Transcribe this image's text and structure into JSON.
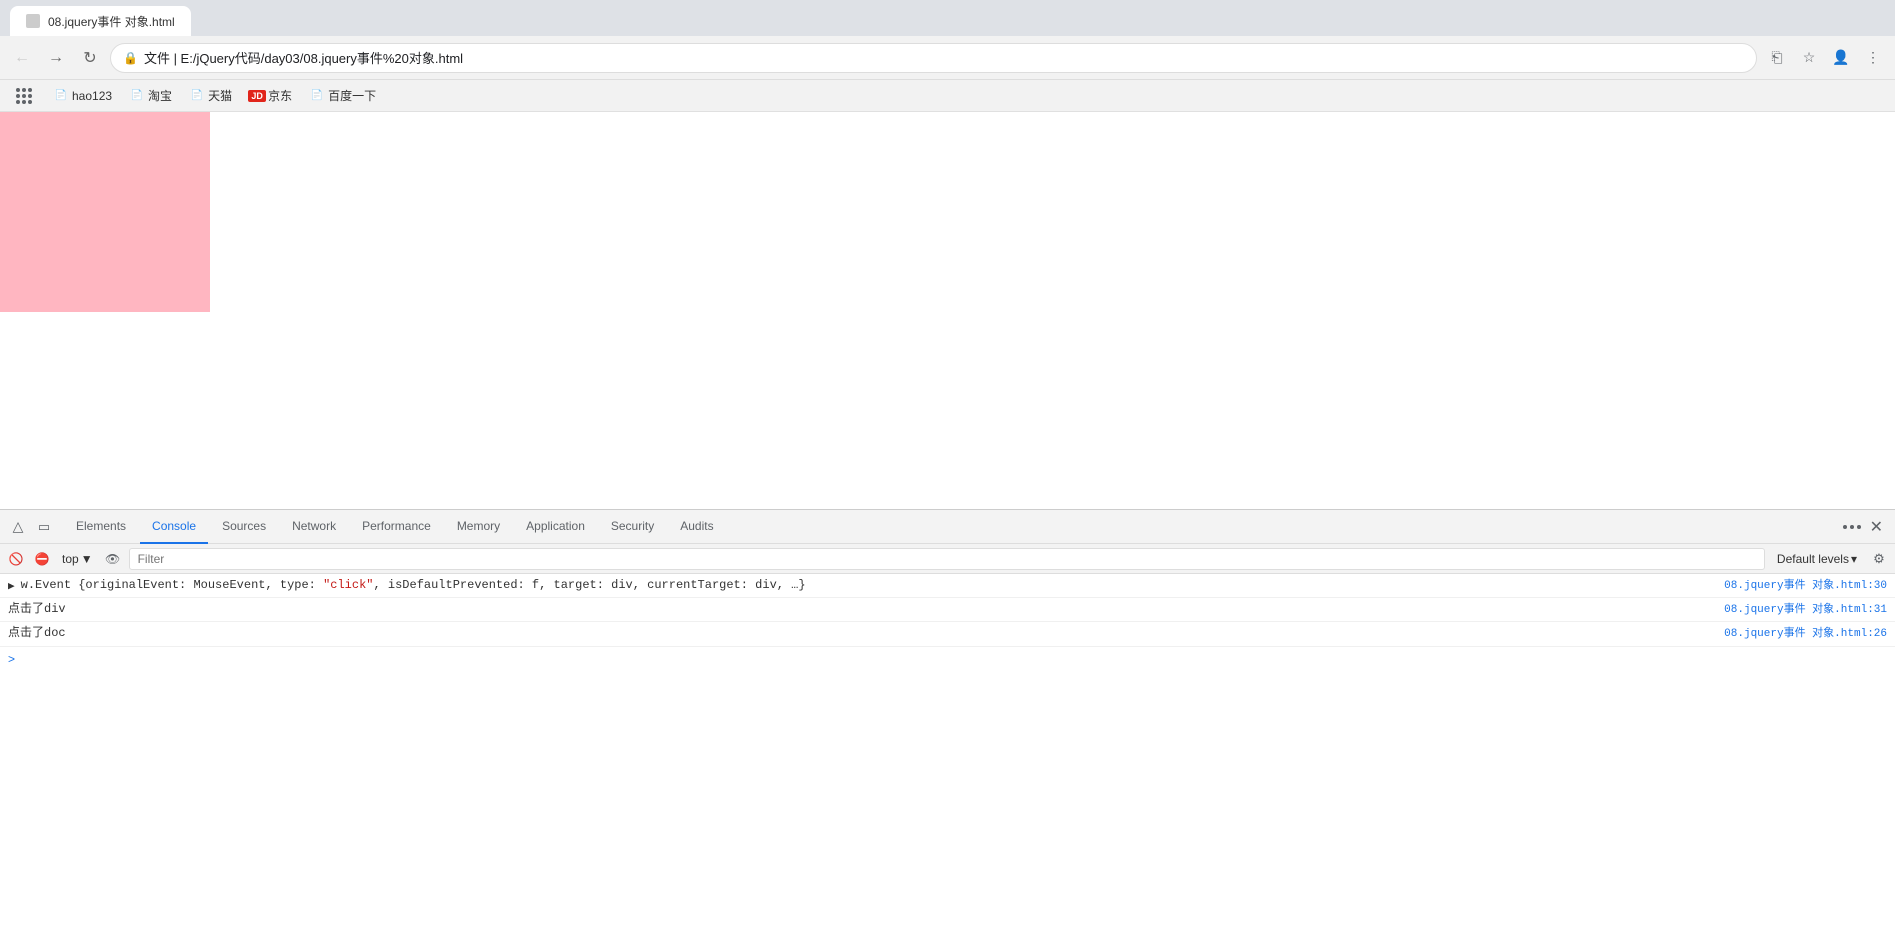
{
  "browser": {
    "tab": {
      "title": "08.jquery事件 对象.html"
    },
    "address": {
      "lock_icon": "🔒",
      "url": "文件 | E:/jQuery代码/day03/08.jquery事件%20对象.html"
    },
    "nav": {
      "back_label": "←",
      "forward_label": "→",
      "reload_label": "↻"
    },
    "browser_actions": {
      "translate_icon": "⊕",
      "bookmark_icon": "☆",
      "profile_icon": "👤",
      "menu_icon": "⋮"
    }
  },
  "bookmarks": [
    {
      "id": "apps",
      "label": "",
      "type": "apps"
    },
    {
      "id": "hao123",
      "label": "hao123",
      "icon": "📄"
    },
    {
      "id": "taobao",
      "label": "淘宝",
      "icon": "📄"
    },
    {
      "id": "tianmao",
      "label": "天猫",
      "icon": "📄"
    },
    {
      "id": "jd",
      "label": "京东",
      "icon": "jd"
    },
    {
      "id": "baidu",
      "label": "百度一下",
      "icon": "📄"
    }
  ],
  "devtools": {
    "tabs": [
      {
        "id": "elements",
        "label": "Elements"
      },
      {
        "id": "console",
        "label": "Console"
      },
      {
        "id": "sources",
        "label": "Sources"
      },
      {
        "id": "network",
        "label": "Network"
      },
      {
        "id": "performance",
        "label": "Performance"
      },
      {
        "id": "memory",
        "label": "Memory"
      },
      {
        "id": "application",
        "label": "Application"
      },
      {
        "id": "security",
        "label": "Security"
      },
      {
        "id": "audits",
        "label": "Audits"
      }
    ],
    "active_tab": "console",
    "console": {
      "context": "top",
      "filter_placeholder": "Filter",
      "levels": "Default levels",
      "levels_arrow": "▾",
      "lines": [
        {
          "id": "line1",
          "has_arrow": true,
          "text": "w.Event {originalEvent: MouseEvent, type: \"click\", isDefaultPrevented: f, target: div, currentTarget: div, …}",
          "link": "08.jquery事件 对象.html:30"
        },
        {
          "id": "line2",
          "has_arrow": false,
          "text": "点击了div",
          "link": "08.jquery事件 对象.html:31"
        },
        {
          "id": "line3",
          "has_arrow": false,
          "text": "点击了doc",
          "link": "08.jquery事件 对象.html:26"
        }
      ],
      "input_prompt": ">"
    }
  },
  "page": {
    "pink_box": {
      "color": "#ffb6c1"
    }
  }
}
